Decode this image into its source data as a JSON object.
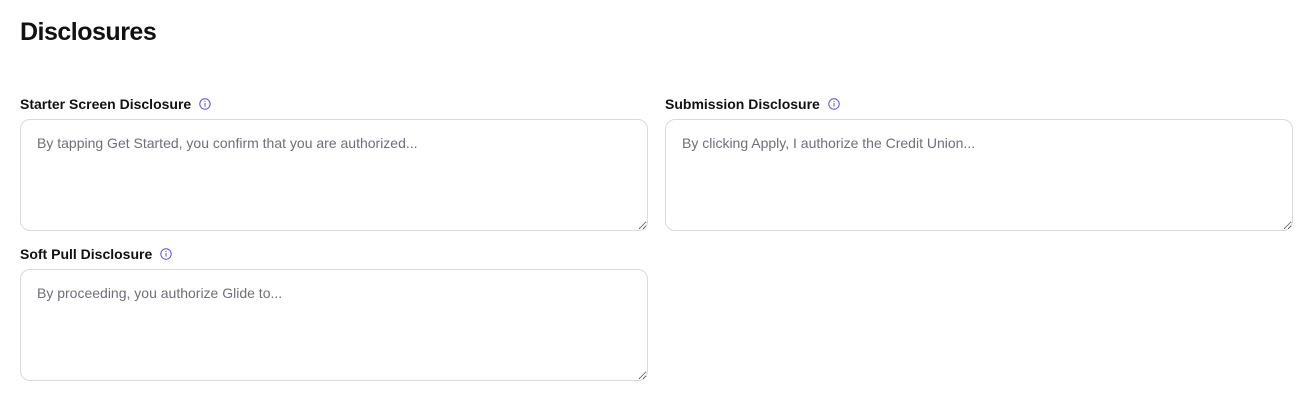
{
  "page": {
    "title": "Disclosures"
  },
  "fields": {
    "starter": {
      "label": "Starter Screen Disclosure",
      "placeholder": "By tapping Get Started, you confirm that you are authorized...",
      "value": ""
    },
    "submission": {
      "label": "Submission Disclosure",
      "placeholder": "By clicking Apply, I authorize the Credit Union...",
      "value": ""
    },
    "softpull": {
      "label": "Soft Pull Disclosure",
      "placeholder": "By proceeding, you authorize Glide to...",
      "value": ""
    }
  },
  "icons": {
    "info": "info-circle-icon"
  },
  "colors": {
    "info_icon": "#5b4fd6",
    "border": "#d9d9de",
    "placeholder": "#6f6f78",
    "text": "#111111"
  }
}
